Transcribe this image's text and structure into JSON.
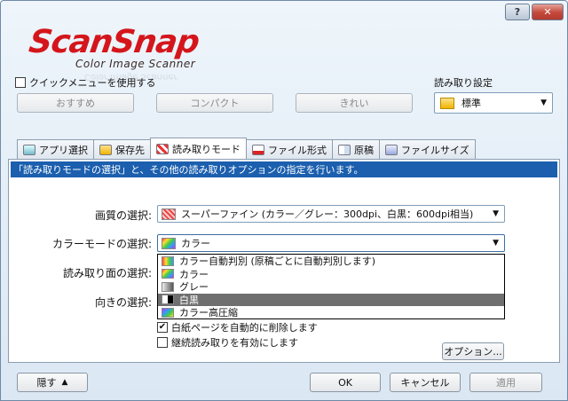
{
  "logo": {
    "main": "ScanSnap",
    "sub": "Color Image Scanner"
  },
  "titlebar": {
    "help_label": "?",
    "close_label": "✕"
  },
  "quick_menu": {
    "label": "クイックメニューを使用する",
    "checked": false
  },
  "quick_buttons": {
    "recommended": "おすすめ",
    "compact": "コンパクト",
    "beautiful": "きれい"
  },
  "read_settings": {
    "label": "読み取り設定",
    "value": "標準"
  },
  "tabs": [
    {
      "label": "アプリ選択"
    },
    {
      "label": "保存先"
    },
    {
      "label": "読み取りモード"
    },
    {
      "label": "ファイル形式"
    },
    {
      "label": "原稿"
    },
    {
      "label": "ファイルサイズ"
    }
  ],
  "panel": {
    "description": "「読み取りモードの選択」と、その他の読み取りオプションの指定を行います。",
    "quality_label": "画質の選択:",
    "quality_value": "スーパーファイン (カラー／グレー：300dpi、白黒：600dpi相当)",
    "color_mode_label": "カラーモードの選択:",
    "color_mode_value": "カラー",
    "side_label": "読み取り面の選択:",
    "orientation_label": "向きの選択:",
    "blank_page_label": "白紙ページを自動的に削除します",
    "blank_page_checked": true,
    "continuous_label": "継続読み取りを有効にします",
    "continuous_checked": false,
    "options_button": "オプション..."
  },
  "color_dropdown": [
    {
      "label": "カラー自動判別 (原稿ごとに自動判別します)",
      "icon": "auto-color-icon",
      "selected": false
    },
    {
      "label": "カラー",
      "icon": "color-icon",
      "selected": false
    },
    {
      "label": "グレー",
      "icon": "gray-icon",
      "selected": false
    },
    {
      "label": "白黒",
      "icon": "black-white-icon",
      "selected": true
    },
    {
      "label": "カラー高圧縮",
      "icon": "color-compress-icon",
      "selected": false
    }
  ],
  "footer": {
    "hide": "隠す",
    "ok": "OK",
    "cancel": "キャンセル",
    "apply": "適用"
  },
  "colors": {
    "accent": "#1b5fae",
    "logo_red": "#d4161c",
    "selected_item": "#6f6f6f"
  }
}
